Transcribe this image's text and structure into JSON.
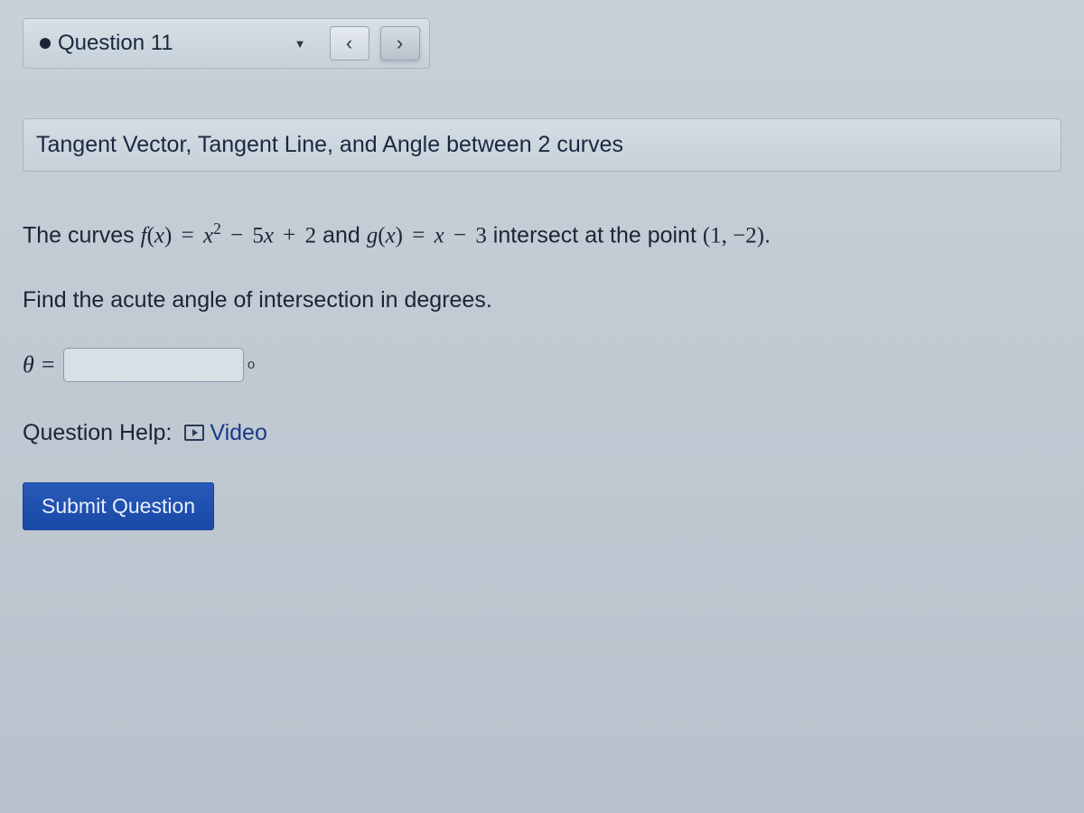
{
  "nav": {
    "question_label": "Question 11",
    "prev_symbol": "‹",
    "next_symbol": "›"
  },
  "topic": {
    "title": "Tangent Vector, Tangent Line, and Angle between 2 curves"
  },
  "problem": {
    "intro": "The curves ",
    "f_name": "f",
    "g_name": "g",
    "var": "x",
    "f_expr_part1": " = ",
    "f_coef_sq": "x",
    "f_exp": "2",
    "f_minus": " − ",
    "f_term2_coef": "5",
    "f_term2_var": "x",
    "f_plus": " + ",
    "f_const": "2",
    "and_text": " and ",
    "g_expr": " = ",
    "g_var": "x",
    "g_minus": " − ",
    "g_const": "3",
    "intersect_text": " intersect at the point ",
    "point": "(1, −2)",
    "period": "."
  },
  "instruction": "Find the acute angle of intersection in degrees.",
  "answer": {
    "theta": "θ",
    "equals": " = ",
    "degree": "o"
  },
  "help": {
    "label": "Question Help:",
    "video_label": "Video"
  },
  "submit": {
    "label": "Submit Question"
  }
}
